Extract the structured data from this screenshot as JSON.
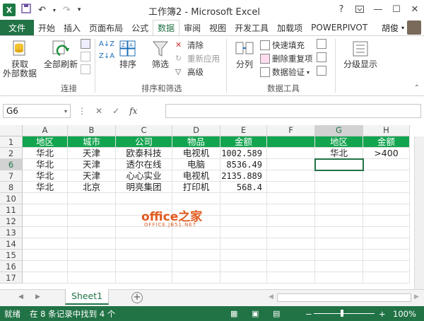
{
  "app": {
    "window_title": "工作簿2 - Microsoft Excel",
    "logo_text": "X",
    "help": "?",
    "user_name": "胡俊"
  },
  "tabs": [
    {
      "label": "文件"
    },
    {
      "label": "开始"
    },
    {
      "label": "插入"
    },
    {
      "label": "页面布局"
    },
    {
      "label": "公式"
    },
    {
      "label": "数据"
    },
    {
      "label": "审阅"
    },
    {
      "label": "视图"
    },
    {
      "label": "开发工具"
    },
    {
      "label": "加载项"
    },
    {
      "label": "POWERPIVOT"
    }
  ],
  "ribbon": {
    "get_external": "获取\n外部数据",
    "refresh_all": "全部刷新",
    "group_connections": "连接",
    "sort": "排序",
    "filter": "筛选",
    "clear": "清除",
    "reapply": "重新应用",
    "advanced": "高级",
    "group_sort_filter": "排序和筛选",
    "split": "分列",
    "flash_fill": "快速填充",
    "remove_dup": "删除重复项",
    "validation": "数据验证",
    "group_data_tools": "数据工具",
    "outline": "分级显示"
  },
  "formula_bar": {
    "name_box": "G6",
    "fx": "fx",
    "formula": ""
  },
  "grid": {
    "columns": [
      "A",
      "B",
      "C",
      "D",
      "E",
      "F",
      "G",
      "H"
    ],
    "rows": [
      {
        "num": "1",
        "cells": [
          "地区",
          "城市",
          "公司",
          "物品",
          "金额",
          "",
          "地区",
          "金额"
        ]
      },
      {
        "num": "2",
        "cells": [
          "华北",
          "天津",
          "欧泰科技",
          "电视机",
          "1002.589",
          "",
          "华北",
          ">400"
        ]
      },
      {
        "num": "6",
        "cells": [
          "华北",
          "天津",
          "透尔在线",
          "电脑",
          "8536.49",
          "",
          "",
          ""
        ]
      },
      {
        "num": "7",
        "cells": [
          "华北",
          "天津",
          "心心实业",
          "电视机",
          "2135.889",
          "",
          "",
          ""
        ]
      },
      {
        "num": "8",
        "cells": [
          "华北",
          "北京",
          "明亮集团",
          "打印机",
          "568.4",
          "",
          "",
          ""
        ]
      },
      {
        "num": "10",
        "cells": [
          "",
          "",
          "",
          "",
          "",
          "",
          "",
          ""
        ]
      },
      {
        "num": "11",
        "cells": [
          "",
          "",
          "",
          "",
          "",
          "",
          "",
          ""
        ]
      },
      {
        "num": "12",
        "cells": [
          "",
          "",
          "",
          "",
          "",
          "",
          "",
          ""
        ]
      },
      {
        "num": "13",
        "cells": [
          "",
          "",
          "",
          "",
          "",
          "",
          "",
          ""
        ]
      },
      {
        "num": "14",
        "cells": [
          "",
          "",
          "",
          "",
          "",
          "",
          "",
          ""
        ]
      },
      {
        "num": "15",
        "cells": [
          "",
          "",
          "",
          "",
          "",
          "",
          "",
          ""
        ]
      },
      {
        "num": "16",
        "cells": [
          "",
          "",
          "",
          "",
          "",
          "",
          "",
          ""
        ]
      },
      {
        "num": "17",
        "cells": [
          "",
          "",
          "",
          "",
          "",
          "",
          "",
          ""
        ]
      }
    ]
  },
  "watermark": {
    "text": "office之家",
    "sub": "OFFICE.JB51.NET"
  },
  "sheets": [
    {
      "label": "Sheet1"
    }
  ],
  "status": {
    "ready": "就绪",
    "message": "在 8 条记录中找到 4 个",
    "zoom": "100%",
    "minus": "−",
    "plus": "+"
  },
  "colors": {
    "accent": "#217346",
    "header_fill": "#13a44f",
    "selection": "#217346"
  }
}
